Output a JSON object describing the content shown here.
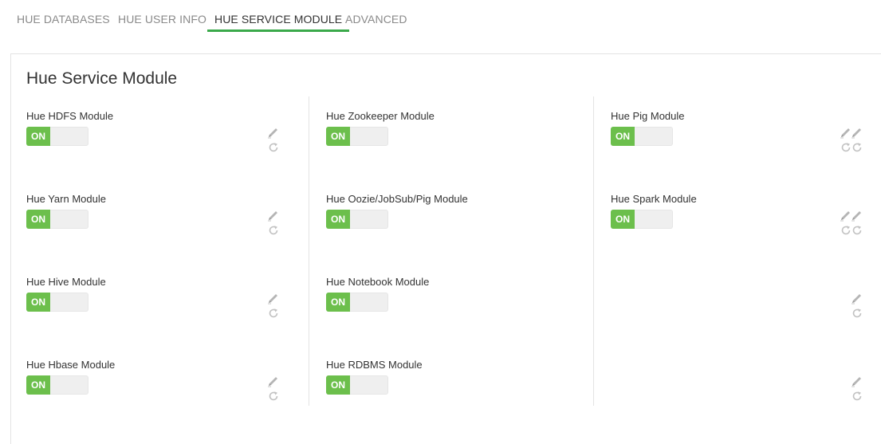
{
  "tabs": [
    {
      "label": "HUE DATABASES",
      "active": false
    },
    {
      "label": "HUE USER INFO",
      "active": false
    },
    {
      "label": "HUE SERVICE MODULE",
      "active": true
    },
    {
      "label": "ADVANCED",
      "active": false
    }
  ],
  "panel": {
    "title": "Hue Service Module"
  },
  "modules": [
    {
      "label": "Hue HDFS Module",
      "state": "ON"
    },
    {
      "label": "Hue Yarn Module",
      "state": "ON"
    },
    {
      "label": "Hue Hive Module",
      "state": "ON"
    },
    {
      "label": "Hue Hbase Module",
      "state": "ON"
    },
    {
      "label": "Hue Zookeeper Module",
      "state": "ON"
    },
    {
      "label": "Hue Oozie/JobSub/Pig Module",
      "state": "ON"
    },
    {
      "label": "Hue Notebook Module",
      "state": "ON"
    },
    {
      "label": "Hue RDBMS Module",
      "state": "ON"
    },
    {
      "label": "Hue Pig Module",
      "state": "ON"
    },
    {
      "label": "Hue Spark Module",
      "state": "ON"
    }
  ],
  "icons": {
    "edit": "pencil-icon",
    "refresh": "refresh-icon"
  },
  "colors": {
    "accent": "#3aa94a",
    "toggle_on": "#6cbf4c",
    "toggle_off": "#eeeeee",
    "icon": "#b0b0b0"
  }
}
